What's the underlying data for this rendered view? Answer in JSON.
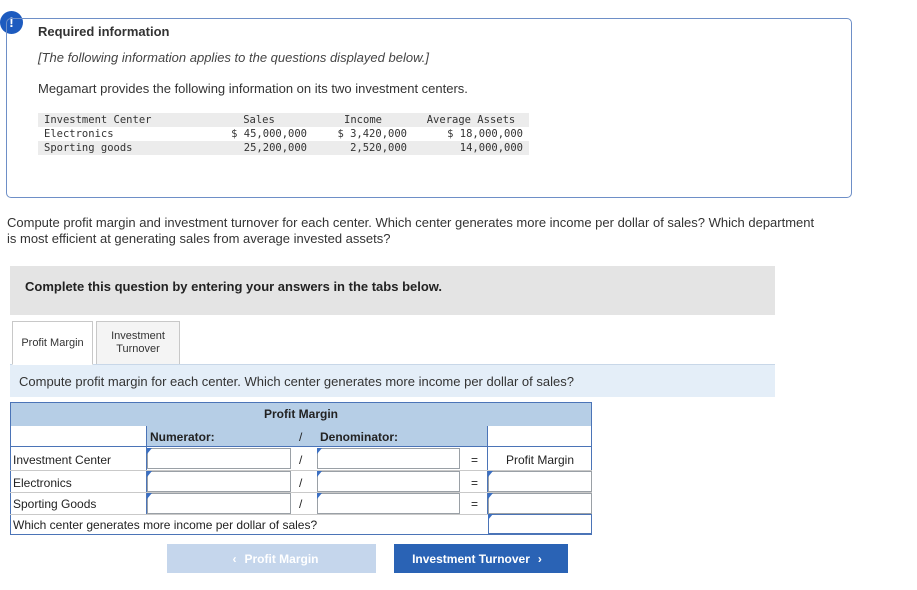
{
  "required": {
    "title": "Required information",
    "note": "[The following information applies to the questions displayed below.]",
    "description": "Megamart provides the following information on its two investment centers."
  },
  "info_table": {
    "headers": [
      "Investment Center",
      "Sales",
      "Income",
      "Average Assets"
    ],
    "rows": [
      [
        "Electronics",
        "$ 45,000,000",
        "$ 3,420,000",
        "$ 18,000,000"
      ],
      [
        "Sporting goods",
        "25,200,000",
        "2,520,000",
        "14,000,000"
      ]
    ]
  },
  "question": "Compute profit margin and investment turnover for each center. Which center generates more income per dollar of sales? Which department is most efficient at generating sales from average invested assets?",
  "complete_bar": "Complete this question by entering your answers in the tabs below.",
  "tabs": [
    {
      "label": "Profit Margin",
      "active": true
    },
    {
      "label": "Investment Turnover",
      "active": false
    }
  ],
  "sub_question": "Compute profit margin for each center. Which center generates more income per dollar of sales?",
  "grid": {
    "title": "Profit Margin",
    "numerator_label": "Numerator:",
    "divider": "/",
    "denominator_label": "Denominator:",
    "equals": "=",
    "result_label": "Profit Margin",
    "rows": [
      "Investment Center",
      "Electronics",
      "Sporting Goods"
    ],
    "final_question": "Which center generates more income per dollar of sales?"
  },
  "nav": {
    "prev_label": "Profit Margin",
    "next_label": "Investment Turnover",
    "prev_icon": "chevron-left-icon",
    "next_icon": "chevron-right-icon"
  },
  "colors": {
    "accent": "#2a63b5",
    "header_fill": "#b6cee6",
    "sub_bar": "#e4eef8"
  }
}
